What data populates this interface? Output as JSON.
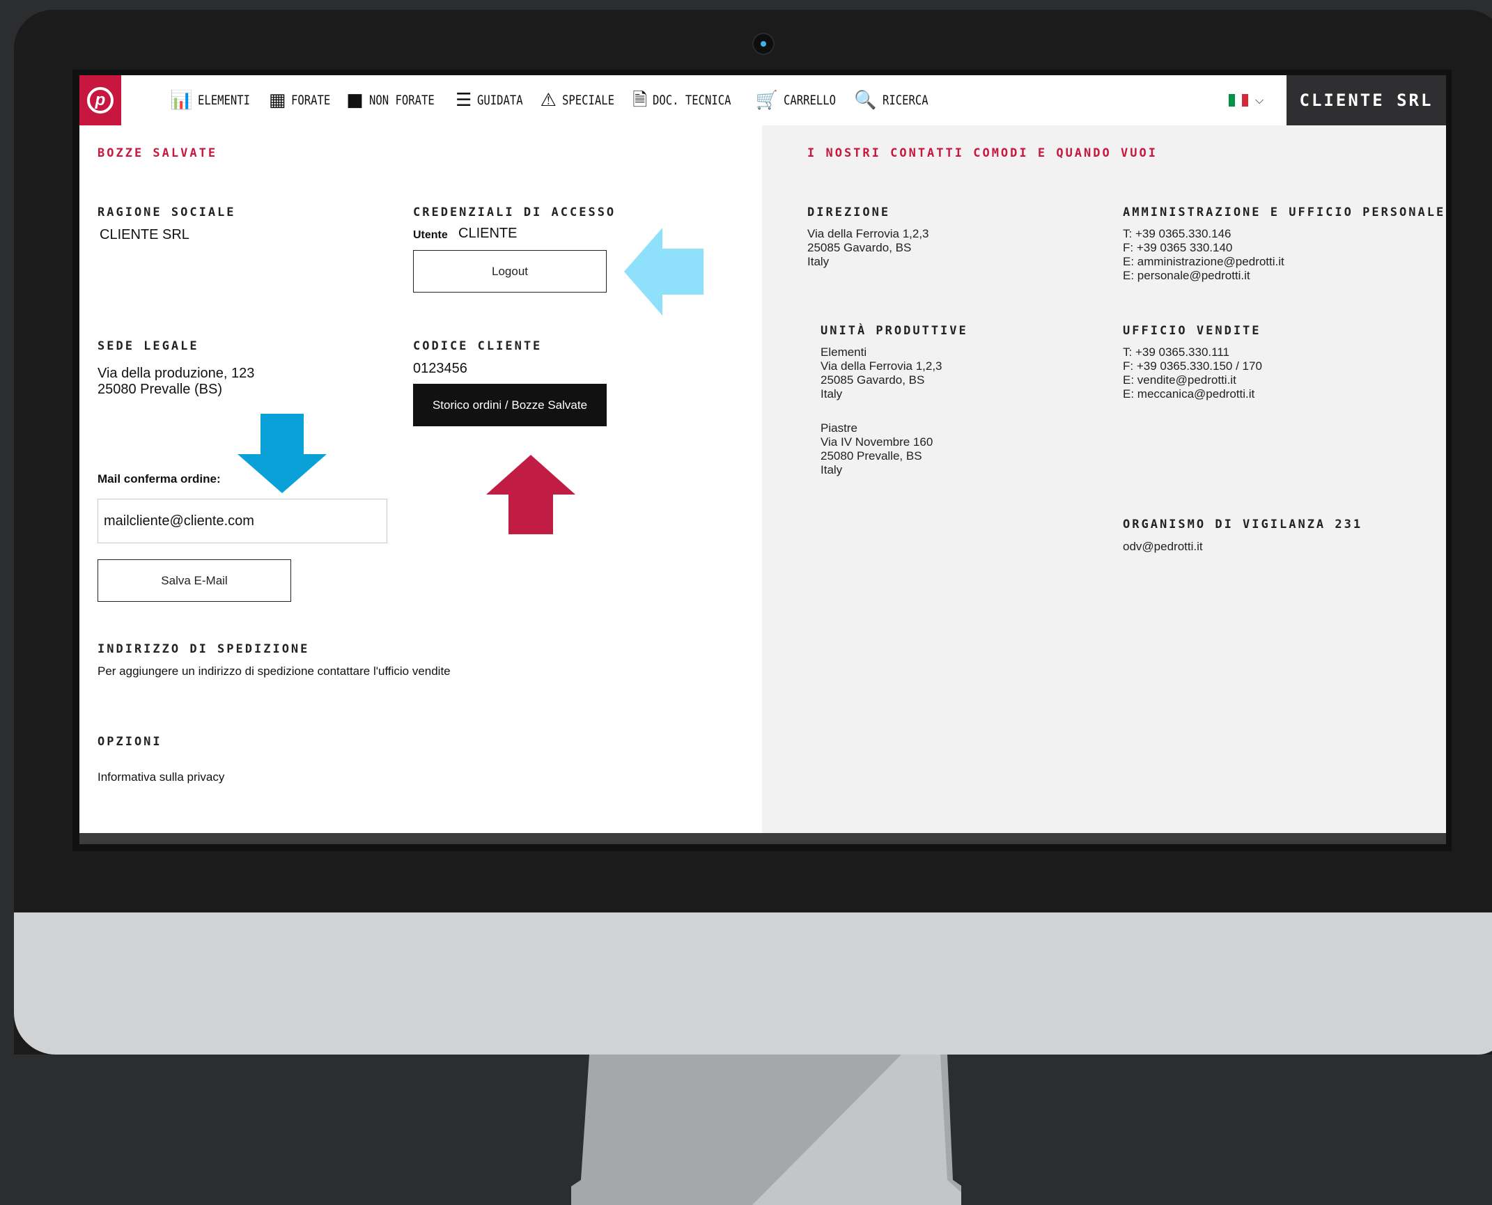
{
  "nav": {
    "items": [
      {
        "icon": "bar-chart-icon",
        "glyph": "📊",
        "label": "Elementi"
      },
      {
        "icon": "film-frame-icon",
        "glyph": "▦",
        "label": "Forate"
      },
      {
        "icon": "solid-square-icon",
        "glyph": "■",
        "label": "Non Forate"
      },
      {
        "icon": "rail-guide-icon",
        "glyph": "☰",
        "label": "Guidata"
      },
      {
        "icon": "warning-triangle-icon",
        "glyph": "⚠",
        "label": "Speciale"
      },
      {
        "icon": "document-icon",
        "glyph": "🗎",
        "label": "Doc. Tecnica"
      },
      {
        "icon": "cart-icon",
        "glyph": "🛒",
        "label": "Carrello"
      },
      {
        "icon": "search-icon",
        "glyph": "🔍",
        "label": "Ricerca"
      }
    ],
    "account_label": "CLIENTE SRL",
    "flag_colors": [
      "#009246",
      "#ffffff",
      "#ce2b37"
    ]
  },
  "left": {
    "page_title": "BOZZE SALVATE",
    "ragione_sociale": {
      "heading": "RAGIONE SOCIALE",
      "value": "CLIENTE SRL"
    },
    "credenziali": {
      "heading": "CREDENZIALI DI ACCESSO",
      "user_label": "Utente",
      "user_value": "CLIENTE",
      "logout_label": "Logout"
    },
    "sede_legale": {
      "heading": "SEDE LEGALE",
      "line1": "Via della produzione, 123",
      "line2": "25080 Prevalle (BS)"
    },
    "codice_cliente": {
      "heading": "CODICE CLIENTE",
      "value": "0123456",
      "orders_button": "Storico ordini / Bozze Salvate"
    },
    "mail": {
      "label": "Mail conferma ordine:",
      "value": "mailcliente@cliente.com",
      "save_button": "Salva E-Mail"
    },
    "spedizione": {
      "heading": "INDIRIZZO DI SPEDIZIONE",
      "text": "Per aggiungere un indirizzo di spedizione contattare l'ufficio vendite"
    },
    "opzioni": {
      "heading": "OPZIONI",
      "privacy_link": "Informativa sulla privacy"
    }
  },
  "right": {
    "title": "I NOSTRI CONTATTI COMODI E QUANDO VUOI",
    "direzione": {
      "heading": "DIREZIONE",
      "lines": "Via della Ferrovia 1,2,3\n25085 Gavardo, BS\nItaly"
    },
    "amministrazione": {
      "heading": "AMMINISTRAZIONE E UFFICIO PERSONALE",
      "lines": "T: +39 0365.330.146\nF: +39 0365 330.140\nE: amministrazione@pedrotti.it\nE: personale@pedrotti.it"
    },
    "unita": {
      "heading": "UNITÀ PRODUTTIVE",
      "elementi": "Elementi\nVia della Ferrovia 1,2,3\n25085 Gavardo, BS\nItaly",
      "piastre": "Piastre\nVia IV Novembre 160\n25080 Prevalle, BS\nItaly"
    },
    "vendite": {
      "heading": "UFFICIO VENDITE",
      "lines": "T: +39 0365.330.111\nF: +39 0365.330.150 / 170\nE: vendite@pedrotti.it\nE: meccanica@pedrotti.it"
    },
    "vigilanza": {
      "heading": "ORGANISMO DI VIGILANZA 231",
      "email": "odv@pedrotti.it"
    }
  },
  "arrows": {
    "light_blue": "#8ee0fb",
    "blue": "#0aa0d8",
    "red": "#c11d44"
  },
  "colors": {
    "brand_red": "#c8173f",
    "dark": "#2f2f31"
  }
}
